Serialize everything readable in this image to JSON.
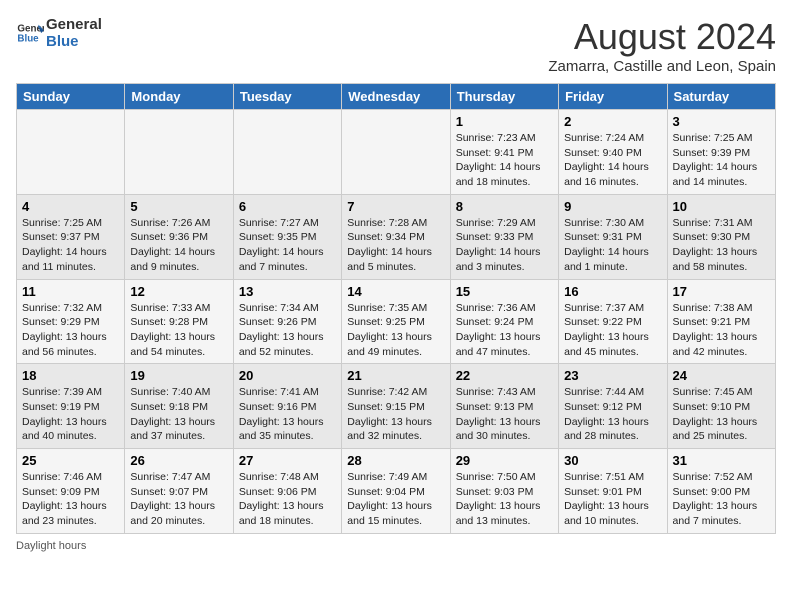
{
  "logo": {
    "line1": "General",
    "line2": "Blue"
  },
  "title": "August 2024",
  "subtitle": "Zamarra, Castille and Leon, Spain",
  "days_of_week": [
    "Sunday",
    "Monday",
    "Tuesday",
    "Wednesday",
    "Thursday",
    "Friday",
    "Saturday"
  ],
  "weeks": [
    [
      {
        "day": "",
        "info": ""
      },
      {
        "day": "",
        "info": ""
      },
      {
        "day": "",
        "info": ""
      },
      {
        "day": "",
        "info": ""
      },
      {
        "day": "1",
        "info": "Sunrise: 7:23 AM\nSunset: 9:41 PM\nDaylight: 14 hours and 18 minutes."
      },
      {
        "day": "2",
        "info": "Sunrise: 7:24 AM\nSunset: 9:40 PM\nDaylight: 14 hours and 16 minutes."
      },
      {
        "day": "3",
        "info": "Sunrise: 7:25 AM\nSunset: 9:39 PM\nDaylight: 14 hours and 14 minutes."
      }
    ],
    [
      {
        "day": "4",
        "info": "Sunrise: 7:25 AM\nSunset: 9:37 PM\nDaylight: 14 hours and 11 minutes."
      },
      {
        "day": "5",
        "info": "Sunrise: 7:26 AM\nSunset: 9:36 PM\nDaylight: 14 hours and 9 minutes."
      },
      {
        "day": "6",
        "info": "Sunrise: 7:27 AM\nSunset: 9:35 PM\nDaylight: 14 hours and 7 minutes."
      },
      {
        "day": "7",
        "info": "Sunrise: 7:28 AM\nSunset: 9:34 PM\nDaylight: 14 hours and 5 minutes."
      },
      {
        "day": "8",
        "info": "Sunrise: 7:29 AM\nSunset: 9:33 PM\nDaylight: 14 hours and 3 minutes."
      },
      {
        "day": "9",
        "info": "Sunrise: 7:30 AM\nSunset: 9:31 PM\nDaylight: 14 hours and 1 minute."
      },
      {
        "day": "10",
        "info": "Sunrise: 7:31 AM\nSunset: 9:30 PM\nDaylight: 13 hours and 58 minutes."
      }
    ],
    [
      {
        "day": "11",
        "info": "Sunrise: 7:32 AM\nSunset: 9:29 PM\nDaylight: 13 hours and 56 minutes."
      },
      {
        "day": "12",
        "info": "Sunrise: 7:33 AM\nSunset: 9:28 PM\nDaylight: 13 hours and 54 minutes."
      },
      {
        "day": "13",
        "info": "Sunrise: 7:34 AM\nSunset: 9:26 PM\nDaylight: 13 hours and 52 minutes."
      },
      {
        "day": "14",
        "info": "Sunrise: 7:35 AM\nSunset: 9:25 PM\nDaylight: 13 hours and 49 minutes."
      },
      {
        "day": "15",
        "info": "Sunrise: 7:36 AM\nSunset: 9:24 PM\nDaylight: 13 hours and 47 minutes."
      },
      {
        "day": "16",
        "info": "Sunrise: 7:37 AM\nSunset: 9:22 PM\nDaylight: 13 hours and 45 minutes."
      },
      {
        "day": "17",
        "info": "Sunrise: 7:38 AM\nSunset: 9:21 PM\nDaylight: 13 hours and 42 minutes."
      }
    ],
    [
      {
        "day": "18",
        "info": "Sunrise: 7:39 AM\nSunset: 9:19 PM\nDaylight: 13 hours and 40 minutes."
      },
      {
        "day": "19",
        "info": "Sunrise: 7:40 AM\nSunset: 9:18 PM\nDaylight: 13 hours and 37 minutes."
      },
      {
        "day": "20",
        "info": "Sunrise: 7:41 AM\nSunset: 9:16 PM\nDaylight: 13 hours and 35 minutes."
      },
      {
        "day": "21",
        "info": "Sunrise: 7:42 AM\nSunset: 9:15 PM\nDaylight: 13 hours and 32 minutes."
      },
      {
        "day": "22",
        "info": "Sunrise: 7:43 AM\nSunset: 9:13 PM\nDaylight: 13 hours and 30 minutes."
      },
      {
        "day": "23",
        "info": "Sunrise: 7:44 AM\nSunset: 9:12 PM\nDaylight: 13 hours and 28 minutes."
      },
      {
        "day": "24",
        "info": "Sunrise: 7:45 AM\nSunset: 9:10 PM\nDaylight: 13 hours and 25 minutes."
      }
    ],
    [
      {
        "day": "25",
        "info": "Sunrise: 7:46 AM\nSunset: 9:09 PM\nDaylight: 13 hours and 23 minutes."
      },
      {
        "day": "26",
        "info": "Sunrise: 7:47 AM\nSunset: 9:07 PM\nDaylight: 13 hours and 20 minutes."
      },
      {
        "day": "27",
        "info": "Sunrise: 7:48 AM\nSunset: 9:06 PM\nDaylight: 13 hours and 18 minutes."
      },
      {
        "day": "28",
        "info": "Sunrise: 7:49 AM\nSunset: 9:04 PM\nDaylight: 13 hours and 15 minutes."
      },
      {
        "day": "29",
        "info": "Sunrise: 7:50 AM\nSunset: 9:03 PM\nDaylight: 13 hours and 13 minutes."
      },
      {
        "day": "30",
        "info": "Sunrise: 7:51 AM\nSunset: 9:01 PM\nDaylight: 13 hours and 10 minutes."
      },
      {
        "day": "31",
        "info": "Sunrise: 7:52 AM\nSunset: 9:00 PM\nDaylight: 13 hours and 7 minutes."
      }
    ]
  ],
  "footer": "Daylight hours"
}
